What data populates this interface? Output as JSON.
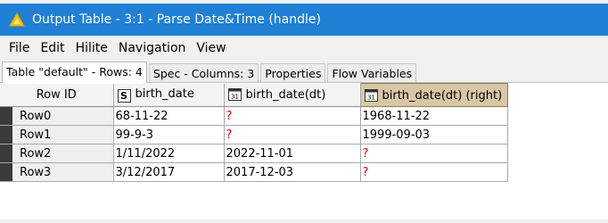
{
  "window": {
    "title": "Output Table - 3:1 - Parse Date&Time (handle)"
  },
  "menu": [
    "File",
    "Edit",
    "Hilite",
    "Navigation",
    "View"
  ],
  "tabs": [
    {
      "label": "Table \"default\" - Rows: 4",
      "active": true
    },
    {
      "label": "Spec - Columns: 3",
      "active": false
    },
    {
      "label": "Properties",
      "active": false
    },
    {
      "label": "Flow Variables",
      "active": false
    }
  ],
  "table": {
    "headers": {
      "row_id": "Row ID",
      "col1": {
        "label": "birth_date",
        "type_icon": "S"
      },
      "col2": {
        "label": "birth_date(dt)",
        "type_icon": "calendar-icon"
      },
      "col3": {
        "label": "birth_date(dt) (right)",
        "type_icon": "calendar-icon"
      }
    },
    "rows": [
      {
        "id": "Row0",
        "c1": "68-11-22",
        "c2": "?",
        "c3": "1968-11-22"
      },
      {
        "id": "Row1",
        "c1": "99-9-3",
        "c2": "?",
        "c3": "1999-09-03"
      },
      {
        "id": "Row2",
        "c1": "1/11/2022",
        "c2": "2022-11-01",
        "c3": "?"
      },
      {
        "id": "Row3",
        "c1": "3/12/2017",
        "c2": "2017-12-03",
        "c3": "?"
      }
    ]
  },
  "colors": {
    "titlebar": "#1f80d6",
    "selected_header": "#d8c7a4",
    "missing_value": "#e00000"
  }
}
